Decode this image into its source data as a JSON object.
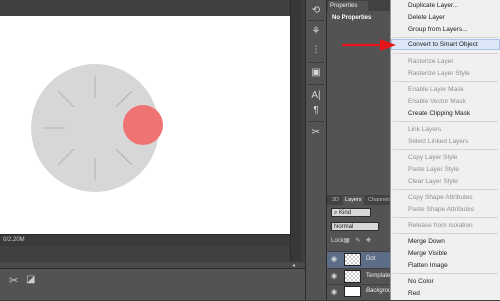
{
  "status_bar": {
    "doc_info": "0/2.20M"
  },
  "properties_panel": {
    "tab_label": "Properties",
    "empty_text": "No Properties"
  },
  "layers_panel": {
    "tabs": [
      "3D",
      "Layers",
      "Channels"
    ],
    "kind_filter": "Kind",
    "blend_mode": "Normal",
    "lock_label": "Lock:",
    "layers": [
      {
        "name": "Dot",
        "selected": true,
        "thumb": "checker"
      },
      {
        "name": "Template",
        "selected": false,
        "thumb": "checker"
      },
      {
        "name": "Background",
        "selected": false,
        "thumb": "white"
      }
    ]
  },
  "context_menu": {
    "items": [
      {
        "label": "Duplicate Layer...",
        "enabled": true
      },
      {
        "label": "Delete Layer",
        "enabled": true
      },
      {
        "label": "Group from Layers...",
        "enabled": true
      },
      {
        "label": "Convert to Smart Object",
        "enabled": true,
        "highlighted": true
      },
      {
        "label": "Rasterize Layer",
        "enabled": false
      },
      {
        "label": "Rasterize Layer Style",
        "enabled": false
      },
      {
        "label": "Enable Layer Mask",
        "enabled": false
      },
      {
        "label": "Enable Vector Mask",
        "enabled": false
      },
      {
        "label": "Create Clipping Mask",
        "enabled": true
      },
      {
        "label": "Link Layers",
        "enabled": false
      },
      {
        "label": "Select Linked Layers",
        "enabled": false
      },
      {
        "label": "Copy Layer Style",
        "enabled": false
      },
      {
        "label": "Paste Layer Style",
        "enabled": false
      },
      {
        "label": "Clear Layer Style",
        "enabled": false
      },
      {
        "label": "Copy Shape Attributes",
        "enabled": false
      },
      {
        "label": "Paste Shape Attributes",
        "enabled": false
      },
      {
        "label": "Release from Isolation",
        "enabled": false
      },
      {
        "label": "Merge Down",
        "enabled": true
      },
      {
        "label": "Merge Visible",
        "enabled": true
      },
      {
        "label": "Flatten Image",
        "enabled": true
      },
      {
        "label": "No Color",
        "enabled": true
      },
      {
        "label": "Red",
        "enabled": true
      }
    ]
  },
  "colors": {
    "canvas_circle": "#d7d7d7",
    "dot": "#f07373",
    "arrow": "#e8141b",
    "menu_highlight": "#dbe7f6",
    "selected_layer": "#5d6d87"
  },
  "icons": {
    "toolstrip": [
      "history-icon",
      "brush-presets-icon",
      "adjustments-icon",
      "styles-icon",
      "character-icon",
      "paragraph-icon",
      "tools-icon"
    ],
    "bottom": [
      "scissors-icon",
      "crop-icon"
    ]
  }
}
